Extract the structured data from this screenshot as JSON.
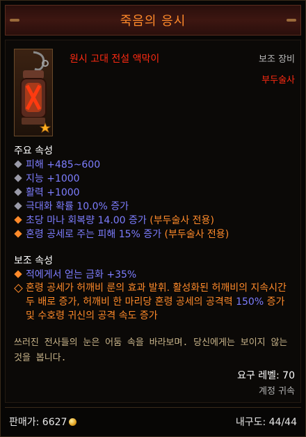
{
  "header": {
    "title": "죽음의 응시"
  },
  "item": {
    "name": "원시 고대 전설 액막이",
    "slot": "보조 장비",
    "class": "부두술사",
    "icon": "amulet-lantern-icon"
  },
  "primary": {
    "heading": "주요 속성",
    "damage": "피해 +485~600",
    "int": "지능 +1000",
    "vit": "활력 +1000",
    "crit": "극대화 확률 10.0% 증가",
    "mana_main": "초당 마나 회복량 14.00 증가 ",
    "mana_tag": "(부두술사 전용)",
    "spirit_main": "혼령 공세로 주는 피해 15% 증가 ",
    "spirit_tag": "(부두술사 전용)"
  },
  "secondary": {
    "heading": "보조 속성",
    "gold": "적에게서 얻는 금화 +35%",
    "legendary_part1": "혼령 공세가 허깨비 룬의 효과 발휘. 활성화된 허깨비의 지속시간 두 배로 증가, 허깨비 한 마리당 혼령 공세의 공격력 ",
    "legendary_value": "150%",
    "legendary_part2": "증가 및 수호령 귀신의 공격 속도 증가"
  },
  "flavor": "쓰러진 전사들의 눈은 어둠 속을 바라보며. 당신에게는 보이지 않는 것을 봅니다.",
  "requirements": {
    "level": "요구 레벨: 70",
    "account": "계정 귀속"
  },
  "footer": {
    "sell_label": "판매가: 6627",
    "durability": "내구도: 44/44"
  },
  "colors": {
    "title": "#ff8a2a",
    "legendary": "#ff2a12",
    "magic": "#7d7dff",
    "orange": "#ff8a2a"
  }
}
